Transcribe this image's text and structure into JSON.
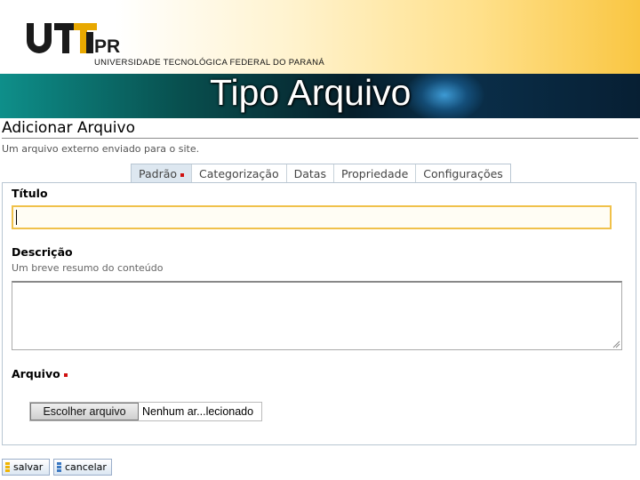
{
  "header": {
    "university": "UNIVERSIDADE TECNOLÓGICA FEDERAL DO PARANÁ",
    "banner_title": "Tipo Arquivo"
  },
  "form": {
    "heading": "Adicionar Arquivo",
    "description": "Um arquivo externo enviado para o site.",
    "tabs": [
      {
        "label": "Padrão",
        "required": true,
        "active": true
      },
      {
        "label": "Categorização"
      },
      {
        "label": "Datas"
      },
      {
        "label": "Propriedade"
      },
      {
        "label": "Configurações"
      }
    ],
    "fields": {
      "title": {
        "label": "Título",
        "value": ""
      },
      "description": {
        "label": "Descrição",
        "help": "Um breve resumo do conteúdo",
        "value": ""
      },
      "file": {
        "label": "Arquivo",
        "required": true,
        "button_label": "Escolher arquivo",
        "status": "Nenhum ar...lecionado"
      }
    }
  },
  "actions": {
    "save_label": "salvar",
    "cancel_label": "cancelar"
  },
  "colors": {
    "required_marker": "#d01010",
    "active_input_border": "#f0c14a",
    "icon_accent": "#f0b400"
  }
}
